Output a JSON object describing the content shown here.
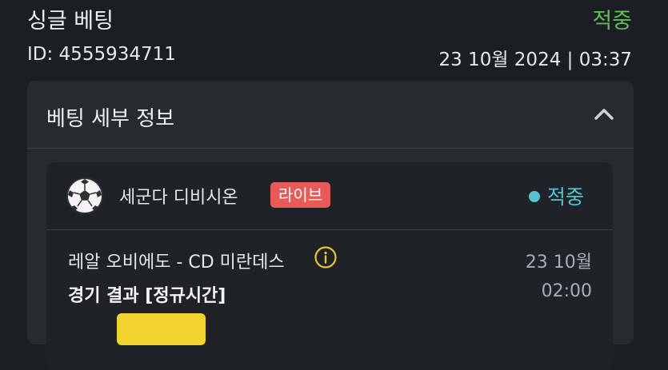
{
  "bet": {
    "type": "싱글 베팅",
    "status": "적중",
    "id_text": "ID: 4555934711",
    "datetime": "23 10월 2024 | 03:37"
  },
  "details": {
    "title": "베팅 세부 정보",
    "toggle_icon": "chevron-up-icon"
  },
  "selection": {
    "sport_icon": "soccer-ball-icon",
    "league": "세군다 디비시온",
    "live_badge": "라이브",
    "result": "적중",
    "match": "레알 오비에도 - CD 미란데스",
    "info_icon": "info-icon",
    "date": "23 10월",
    "market": "경기 결과 [정규시간]",
    "time": "02:00"
  },
  "colors": {
    "background": "#1b1e22",
    "panel": "#272b30",
    "card": "#1f2327",
    "won_green": "#5cbf54",
    "result_teal": "#57c3ce",
    "live_red": "#e85a57",
    "pick_yellow": "#f2d22e"
  }
}
